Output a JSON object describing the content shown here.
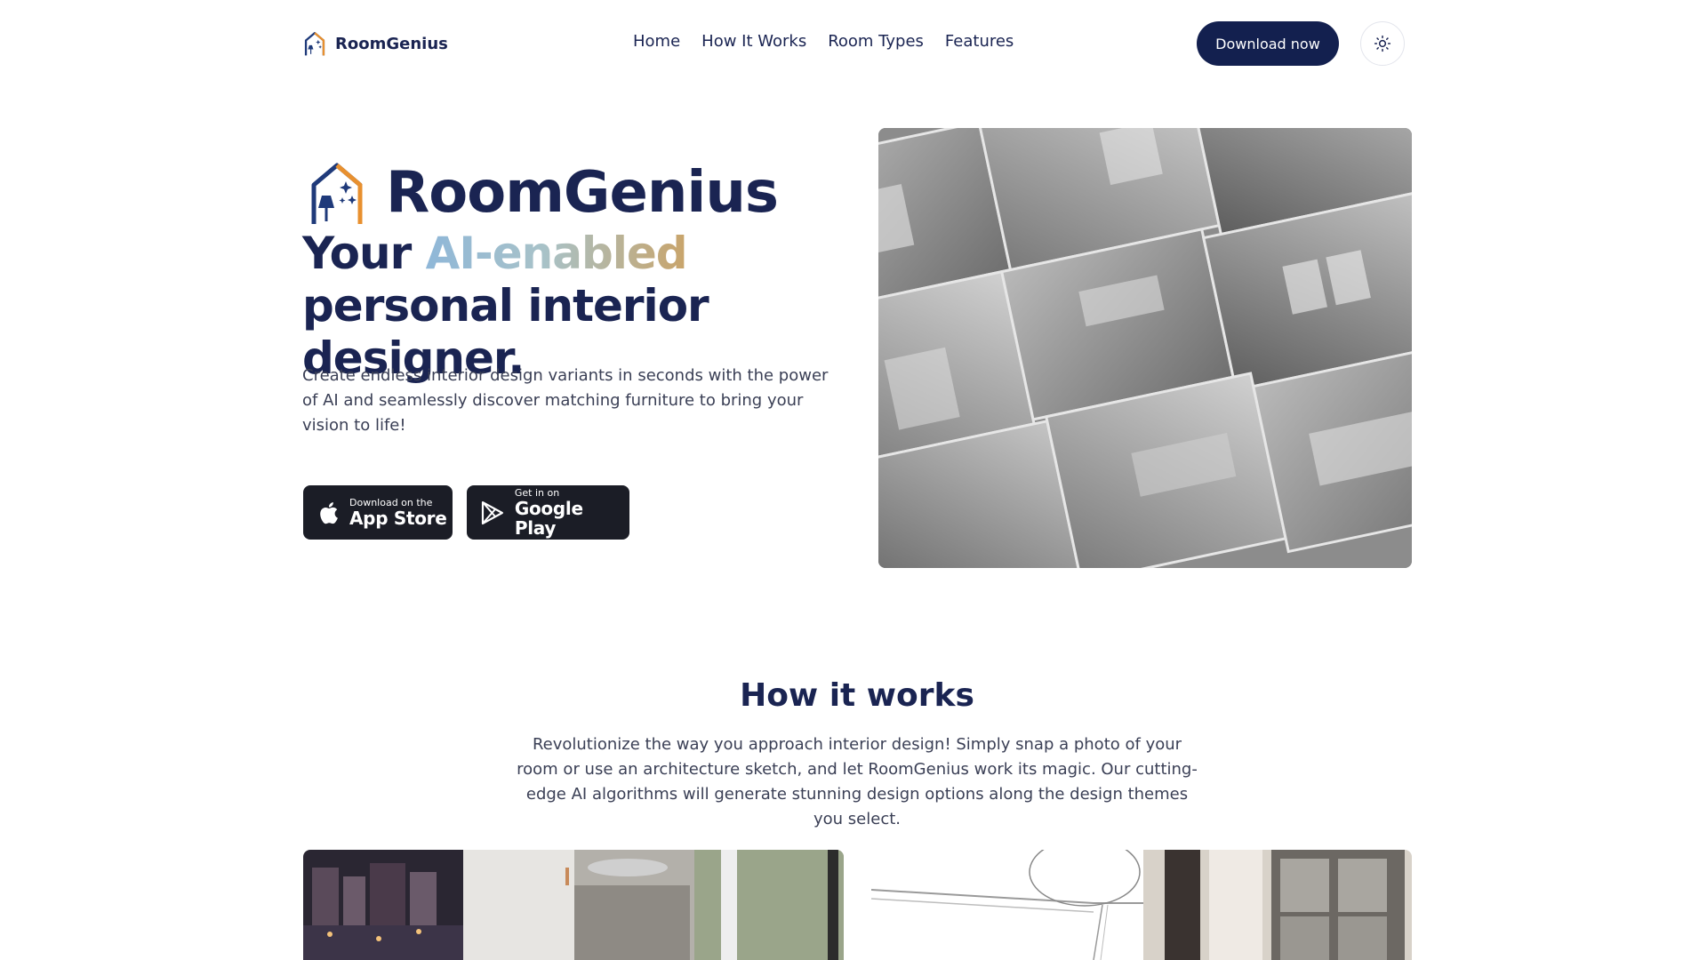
{
  "header": {
    "brand_name": "RoomGenius",
    "nav": [
      "Home",
      "How It Works",
      "Room Types",
      "Features"
    ],
    "download_label": "Download now",
    "theme_icon": "sun-icon"
  },
  "hero": {
    "brand_name": "RoomGenius",
    "title_prefix": "Your ",
    "title_accent": "AI-enabled",
    "title_suffix": " personal interior designer.",
    "description": "Create endless interior design variants in seconds with the power of AI and seamlessly discover matching furniture to bring your vision to life!",
    "app_store": {
      "small": "Download on the",
      "big": "App Store",
      "icon": "apple-icon"
    },
    "google_play": {
      "small": "Get in on",
      "big": "Google Play",
      "icon": "google-play-icon"
    }
  },
  "how_it_works": {
    "title": "How it works",
    "description": "Revolutionize the way you approach interior design! Simply snap a photo of your room or use an architecture sketch, and let RoomGenius work its magic. Our cutting-edge AI algorithms will generate stunning design options along the design themes you select."
  },
  "colors": {
    "navy": "#1a2452",
    "button_dark": "#13204f",
    "logo_orange": "#e8902f",
    "logo_blue": "#1f3a7a",
    "store_bg": "#1b1d26"
  }
}
